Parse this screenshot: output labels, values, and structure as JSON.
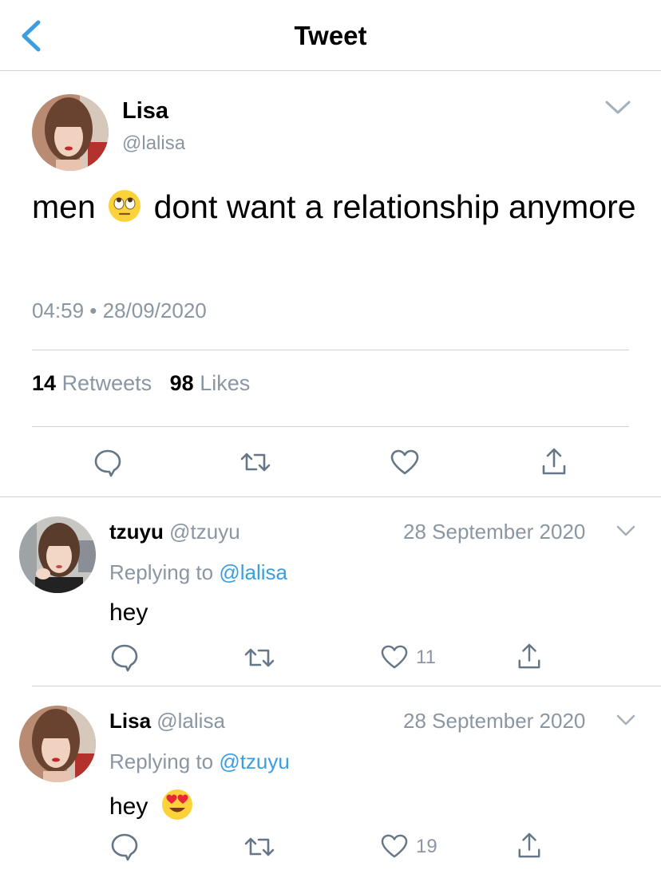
{
  "header": {
    "title": "Tweet"
  },
  "main_tweet": {
    "author_name": "Lisa",
    "author_handle": "@lalisa",
    "text_before_emoji": "men",
    "text_after_emoji": "dont want a relationship anymore",
    "emoji": "face-with-rolling-eyes",
    "timestamp": "04:59 • 28/09/2020",
    "retweets_count": "14",
    "retweets_label": "Retweets",
    "likes_count": "98",
    "likes_label": "Likes"
  },
  "replies": [
    {
      "author_name": "tzuyu",
      "author_handle": "@tzuyu",
      "date": "28 September 2020",
      "replying_label": "Replying to",
      "replying_to": "@lalisa",
      "text": "hey",
      "like_count": "11"
    },
    {
      "author_name": "Lisa",
      "author_handle": "@lalisa",
      "date": "28 September 2020",
      "replying_label": "Replying to",
      "replying_to": "@tzuyu",
      "text": "hey",
      "emoji": "smiling-face-with-heart-eyes",
      "like_count": "19"
    }
  ],
  "colors": {
    "accent": "#3c9ee0",
    "secondary_text": "#8a96a2",
    "divider": "#cfd3d6",
    "icon": "#657786"
  }
}
